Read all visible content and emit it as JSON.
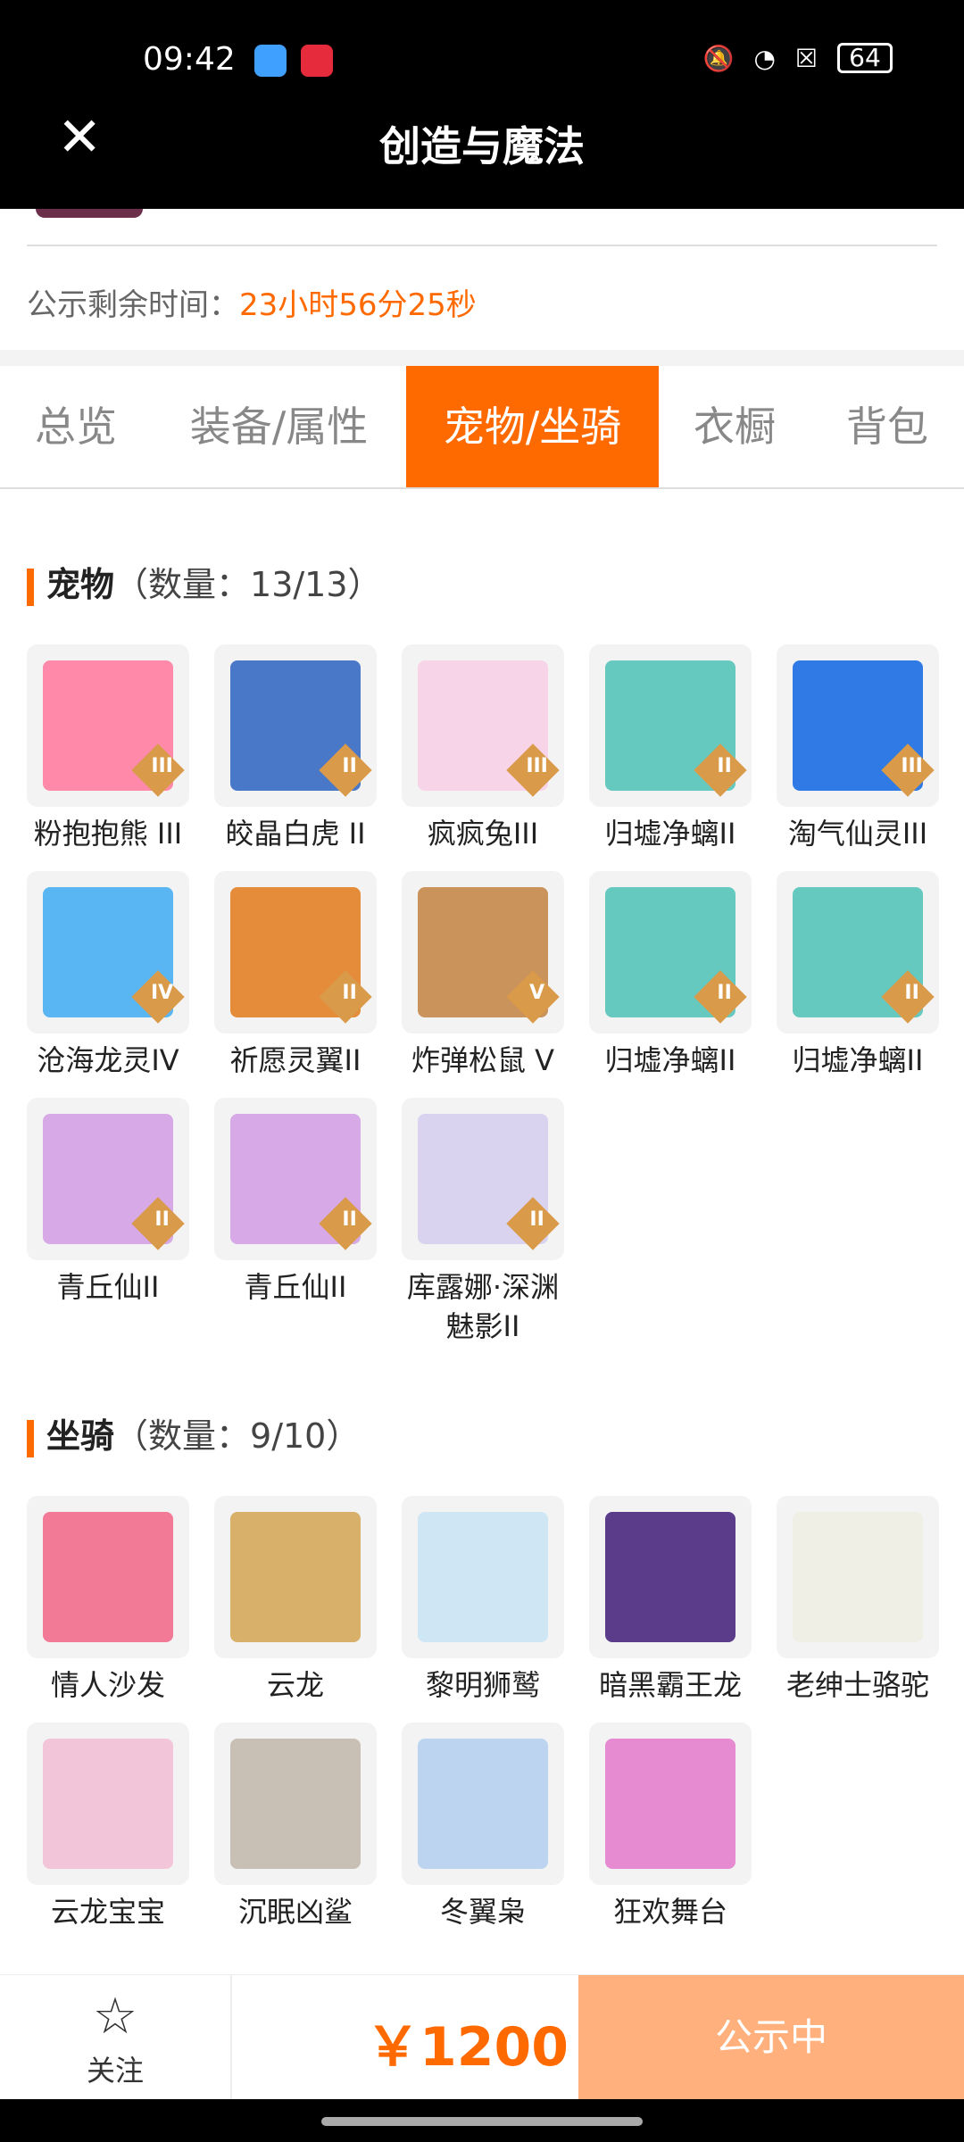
{
  "status_bar": {
    "time": "09:42",
    "battery": "64"
  },
  "header": {
    "title": "创造与魔法"
  },
  "remain": {
    "label": "公示剩余时间：",
    "value": "23小时56分25秒"
  },
  "tabs": [
    {
      "label": "总览"
    },
    {
      "label": "装备/属性"
    },
    {
      "label": "宠物/坐骑"
    },
    {
      "label": "衣橱"
    },
    {
      "label": "背包"
    }
  ],
  "pets": {
    "title": "宠物",
    "count": "（数量：13/13）",
    "items": [
      {
        "name": "粉抱抱熊 III",
        "tier": "III",
        "color": "#ff89a8"
      },
      {
        "name": "皎晶白虎 II",
        "tier": "II",
        "color": "#4a78c9"
      },
      {
        "name": "疯疯兔III",
        "tier": "III",
        "color": "#f7d4e8"
      },
      {
        "name": "归墟净螭II",
        "tier": "II",
        "color": "#66c9c0"
      },
      {
        "name": "淘气仙灵III",
        "tier": "III",
        "color": "#2f7ae5"
      },
      {
        "name": "沧海龙灵IV",
        "tier": "IV",
        "color": "#5ab6f2"
      },
      {
        "name": "祈愿灵翼II",
        "tier": "II",
        "color": "#e58c3b"
      },
      {
        "name": "炸弹松鼠 V",
        "tier": "V",
        "color": "#c9935b"
      },
      {
        "name": "归墟净螭II",
        "tier": "II",
        "color": "#66c9c0"
      },
      {
        "name": "归墟净螭II",
        "tier": "II",
        "color": "#66c9c0"
      },
      {
        "name": "青丘仙II",
        "tier": "II",
        "color": "#d7a9e6"
      },
      {
        "name": "青丘仙II",
        "tier": "II",
        "color": "#d7a9e6"
      },
      {
        "name": "库露娜·深渊魅影II",
        "tier": "II",
        "color": "#d9d3f0"
      }
    ]
  },
  "mounts": {
    "title": "坐骑",
    "count": "（数量：9/10）",
    "items": [
      {
        "name": "情人沙发",
        "color": "#f27a96"
      },
      {
        "name": "云龙",
        "color": "#d9b06a"
      },
      {
        "name": "黎明狮鹫",
        "color": "#cfe6f5"
      },
      {
        "name": "暗黑霸王龙",
        "color": "#5a3c8a"
      },
      {
        "name": "老绅士骆驼",
        "color": "#efefe6"
      },
      {
        "name": "云龙宝宝",
        "color": "#f3c5d8"
      },
      {
        "name": "沉眠凶鲨",
        "color": "#c9c0b5"
      },
      {
        "name": "冬翼枭",
        "color": "#bcd4f0"
      },
      {
        "name": "狂欢舞台",
        "color": "#e68ad2"
      }
    ]
  },
  "footer": {
    "follow": "关注",
    "price": "￥1200",
    "status": "公示中"
  },
  "colors": {
    "accent": "#ff6a00",
    "status_button": "#ffb07c"
  }
}
